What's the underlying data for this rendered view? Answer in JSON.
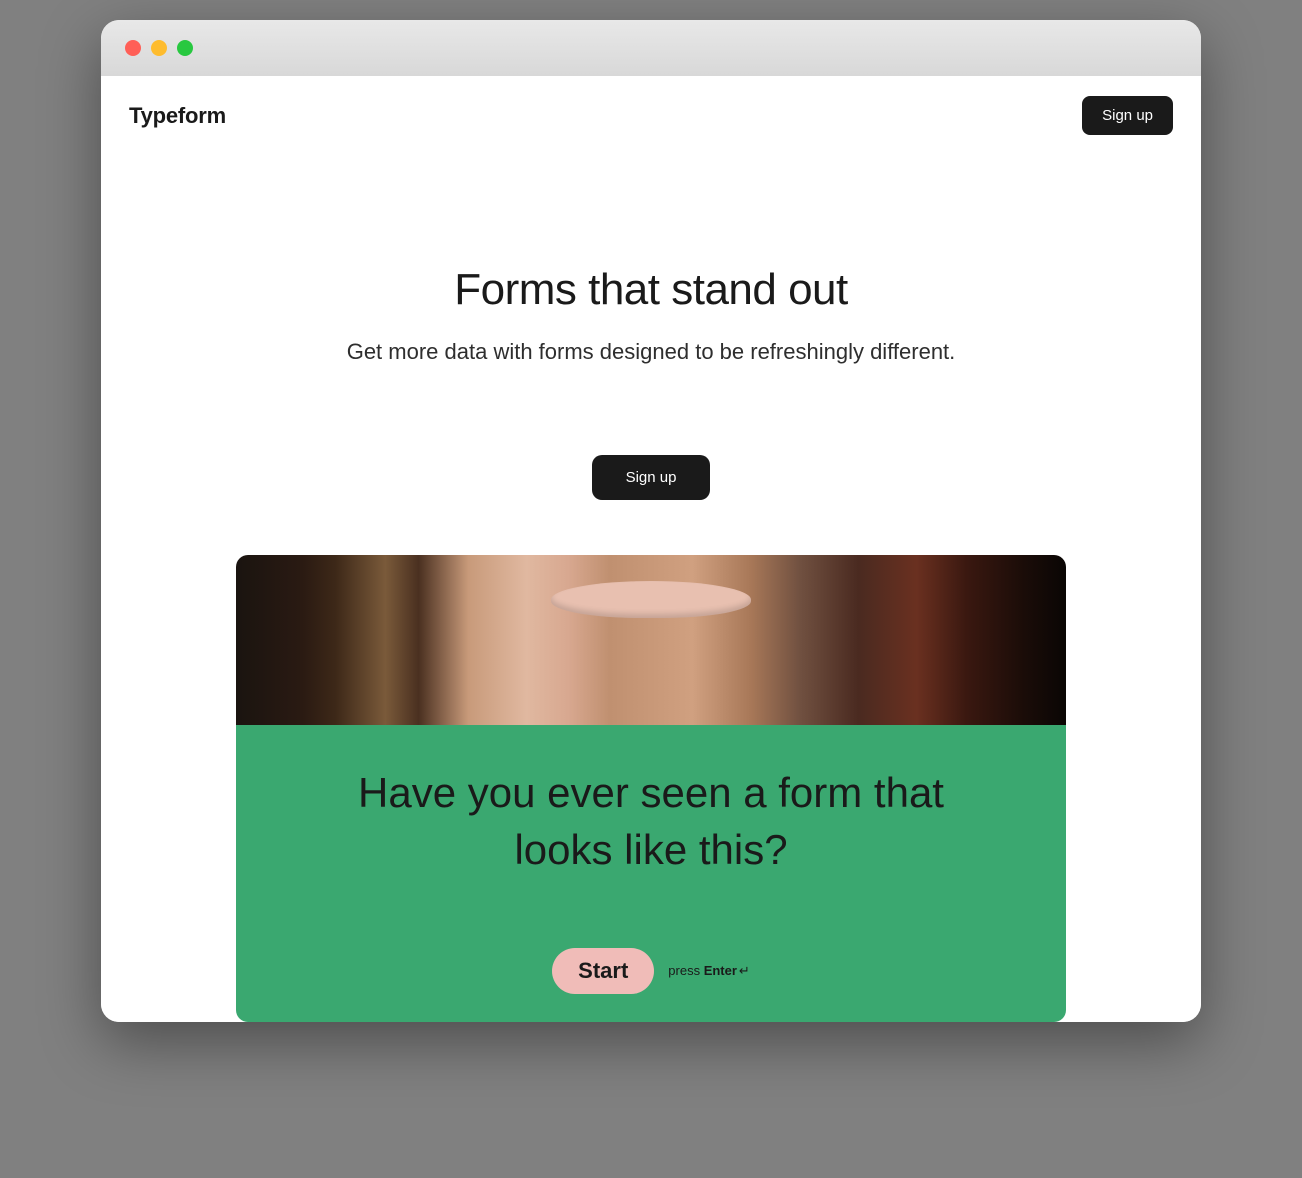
{
  "header": {
    "logo": "Typeform",
    "signup_label": "Sign up"
  },
  "hero": {
    "title": "Forms that stand out",
    "subtitle": "Get more data with forms designed to be refreshingly different.",
    "cta_label": "Sign up"
  },
  "form_preview": {
    "question": "Have you ever seen a form that looks like this?",
    "start_label": "Start",
    "hint_prefix": "press ",
    "hint_key": "Enter",
    "hint_icon": "↵"
  }
}
